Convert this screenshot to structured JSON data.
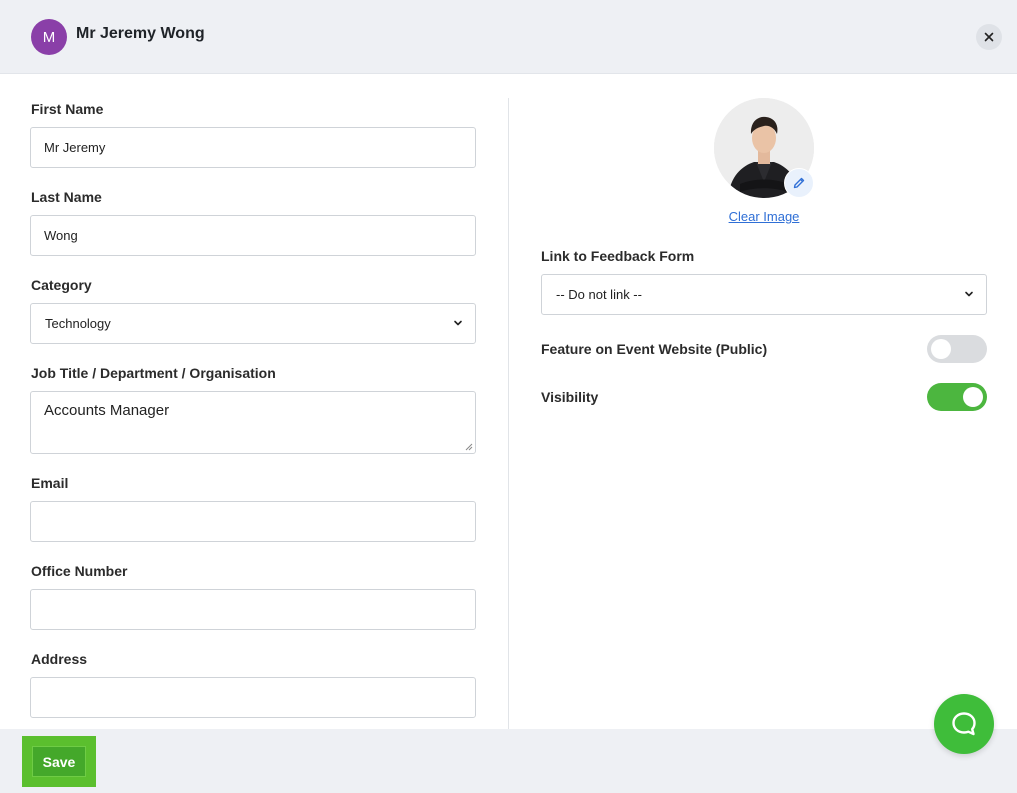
{
  "header": {
    "avatar_initial": "M",
    "title": "Mr Jeremy Wong",
    "close_icon": "close-icon"
  },
  "form": {
    "first_name": {
      "label": "First Name",
      "value": "Mr Jeremy"
    },
    "last_name": {
      "label": "Last Name",
      "value": "Wong"
    },
    "category": {
      "label": "Category",
      "value": "Technology"
    },
    "job_title": {
      "label": "Job Title / Department / Organisation",
      "value": "Accounts Manager"
    },
    "email": {
      "label": "Email",
      "value": ""
    },
    "office_number": {
      "label": "Office Number",
      "value": ""
    },
    "address": {
      "label": "Address",
      "value": ""
    }
  },
  "profile": {
    "clear_image": "Clear Image"
  },
  "feedback": {
    "label": "Link to Feedback Form",
    "value": "-- Do not link --"
  },
  "toggles": {
    "feature": {
      "label": "Feature on Event Website (Public)",
      "on": false
    },
    "visibility": {
      "label": "Visibility",
      "on": true
    }
  },
  "footer": {
    "save_label": "Save"
  },
  "colors": {
    "accent_green": "#44a82a",
    "toggle_on": "#4cb63f",
    "toggle_off": "#dadcdf",
    "link": "#2f6fd6",
    "avatar": "#8a3fa8"
  }
}
